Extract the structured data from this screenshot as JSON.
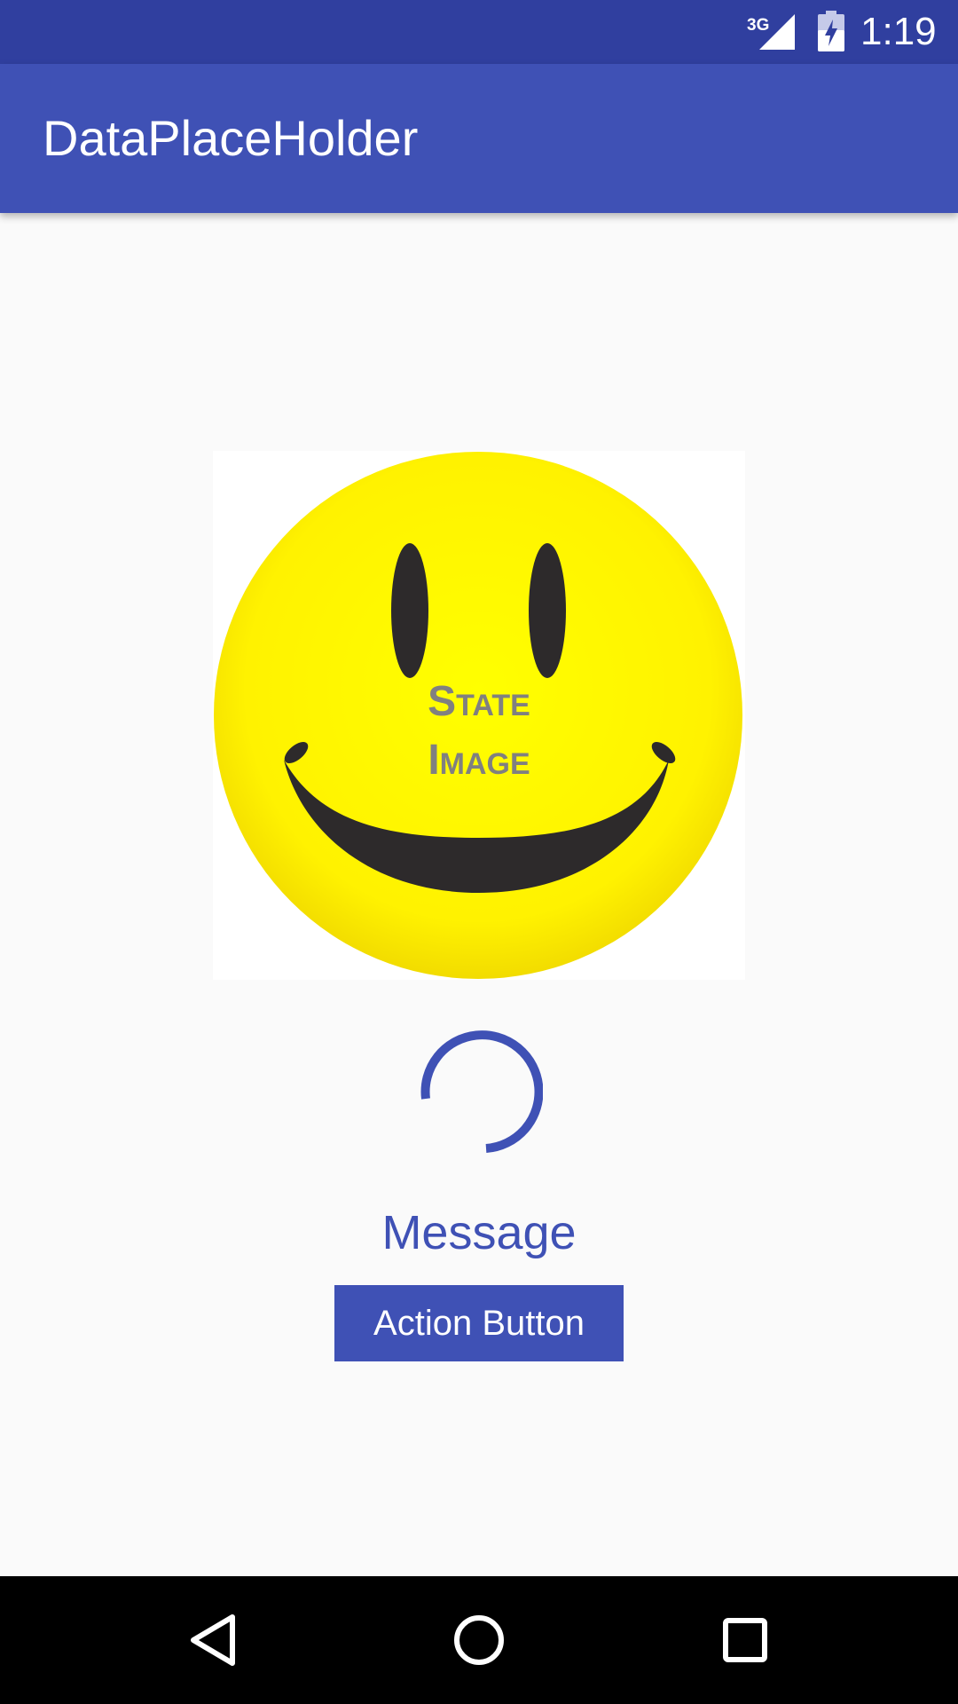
{
  "status_bar": {
    "network": "3G",
    "time": "1:19",
    "icons": [
      "signal-icon",
      "battery-charging-icon"
    ]
  },
  "app_bar": {
    "title": "DataPlaceHolder"
  },
  "content": {
    "image_text_line1": "State",
    "image_text_line2": "Image",
    "message": "Message",
    "action_button_label": "Action Button"
  },
  "nav_bar": {
    "icons": [
      "back-icon",
      "home-icon",
      "recents-icon"
    ]
  },
  "colors": {
    "primary": "#3f51b5",
    "primary_dark": "#303f9f",
    "background": "#fafafa",
    "smiley_yellow": "#fff200"
  }
}
